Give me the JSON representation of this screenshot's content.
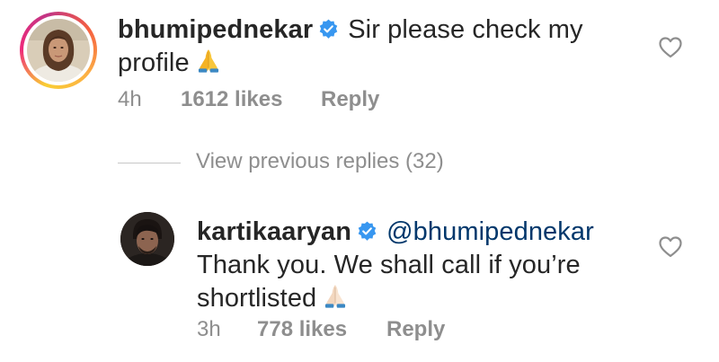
{
  "comment": {
    "username": "bhumipednekar",
    "verified_icon": "verified-badge-icon",
    "text": "Sir please check my profile",
    "emoji": "folded-hands",
    "time": "4h",
    "likes": "1612 likes",
    "reply_label": "Reply",
    "like_icon": "heart-outline-icon"
  },
  "view_replies": {
    "label": "View previous replies (32)"
  },
  "reply": {
    "username": "kartikaaryan",
    "verified_icon": "verified-badge-icon",
    "mention": "@bhumipednekar",
    "text": "Thank you. We shall call if you’re shortlisted",
    "emoji": "folded-hands-light-skin",
    "time": "3h",
    "likes": "778 likes",
    "reply_label": "Reply",
    "like_icon": "heart-outline-icon"
  },
  "colors": {
    "text": "#262626",
    "secondary": "#8e8e8e",
    "verified": "#3897f0",
    "mention": "#00376b",
    "divider": "#c7c7c7"
  }
}
